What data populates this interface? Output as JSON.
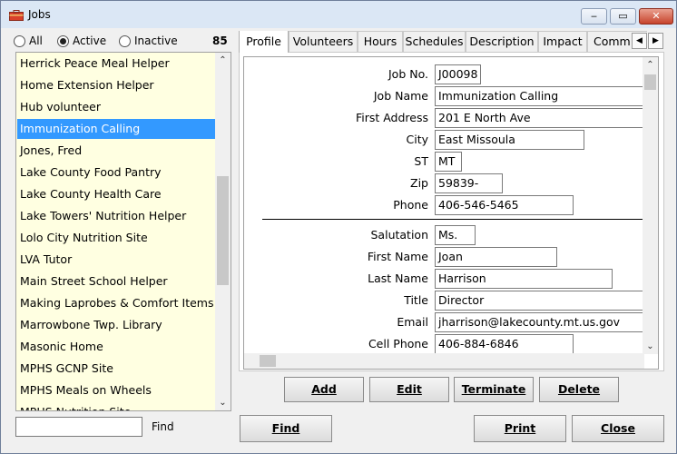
{
  "window": {
    "title": "Jobs"
  },
  "titlebar": {
    "minimize": "‒",
    "maximize": "▭",
    "close": "✕"
  },
  "filter": {
    "options": [
      {
        "label": "All",
        "selected": false
      },
      {
        "label": "Active",
        "selected": true
      },
      {
        "label": "Inactive",
        "selected": false
      }
    ],
    "count": "85"
  },
  "list": {
    "items": [
      "Herrick Peace Meal Helper",
      "Home Extension Helper",
      "Hub volunteer",
      "Immunization Calling",
      "Jones, Fred",
      "Lake County Food Pantry",
      "Lake County Health Care",
      "Lake Towers' Nutrition Helper",
      "Lolo City Nutrition Site",
      "LVA Tutor",
      "Main Street School Helper",
      "Making Laprobes & Comfort Items",
      "Marrowbone Twp. Library",
      "Masonic Home",
      "MPHS GCNP Site",
      "MPHS Meals on Wheels",
      "MPHS Nutrition Site"
    ],
    "selected_index": 3
  },
  "search": {
    "value": "",
    "label": "Find"
  },
  "tabs": [
    "Profile",
    "Volunteers",
    "Hours",
    "Schedules",
    "Description",
    "Impact",
    "Comm"
  ],
  "active_tab": 0,
  "profile": {
    "job_no": {
      "label": "Job No.",
      "value": "J00098"
    },
    "job_name": {
      "label": "Job Name",
      "value": "Immunization Calling"
    },
    "first_address": {
      "label": "First Address",
      "value": "201 E North Ave"
    },
    "city": {
      "label": "City",
      "value": "East Missoula"
    },
    "st": {
      "label": "ST",
      "value": "MT"
    },
    "zip": {
      "label": "Zip",
      "value": "59839-"
    },
    "phone": {
      "label": "Phone",
      "value": "406-546-5465"
    },
    "salutation": {
      "label": "Salutation",
      "value": "Ms."
    },
    "first_name": {
      "label": "First Name",
      "value": "Joan"
    },
    "last_name": {
      "label": "Last Name",
      "value": "Harrison"
    },
    "title": {
      "label": "Title",
      "value": "Director"
    },
    "email": {
      "label": "Email",
      "value": "jharrison@lakecounty.mt.us.gov"
    },
    "cell_phone": {
      "label": "Cell Phone",
      "value": "406-884-6846"
    }
  },
  "actions": {
    "add": "Add",
    "edit": "Edit",
    "terminate": "Terminate",
    "delete": "Delete"
  },
  "footer": {
    "find": "Find",
    "print": "Print",
    "close": "Close"
  },
  "colors": {
    "selection": "#3399ff",
    "list_background": "#ffffe1",
    "close_button": "#c7432c"
  }
}
